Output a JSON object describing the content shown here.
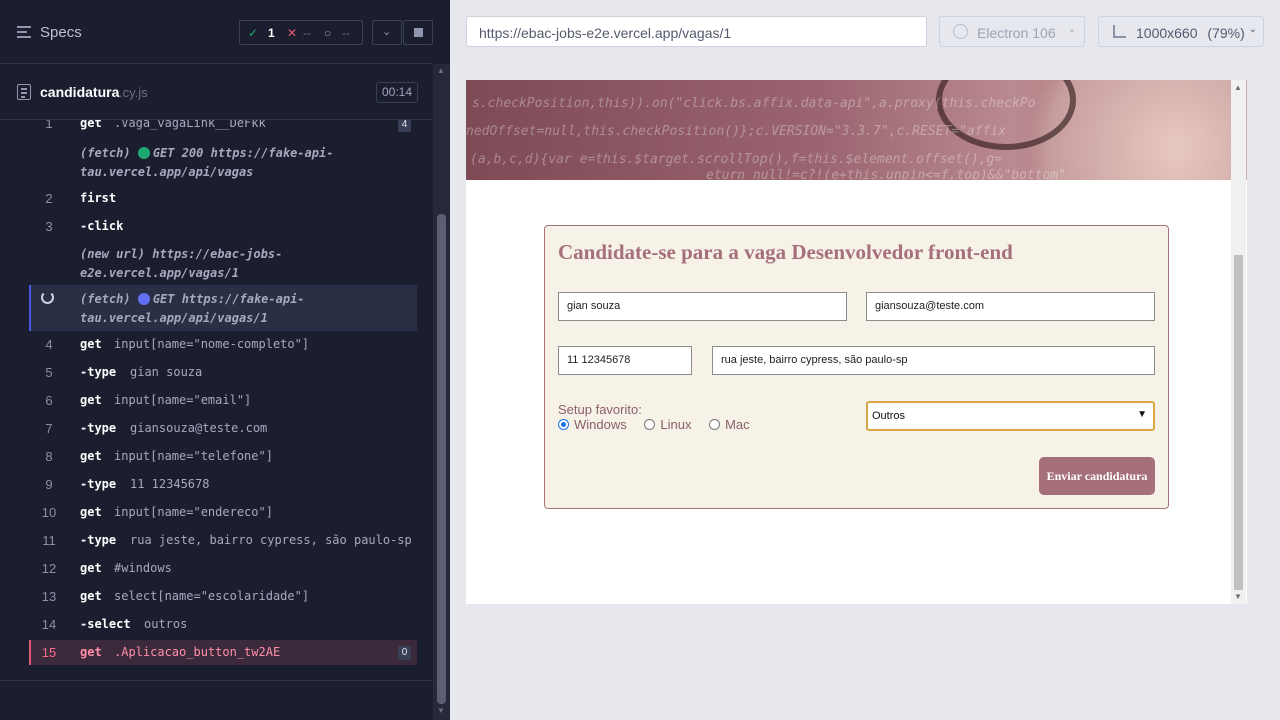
{
  "specs": {
    "label": "Specs",
    "passed": "1",
    "failed": "--",
    "pending": "--"
  },
  "file": {
    "name": "candidatura",
    "ext": ".cy.js",
    "duration": "00:14"
  },
  "commands": [
    {
      "num": "1",
      "name": "get",
      "msg": ".Vaga_vagaLink__DeFkk",
      "badge": "4"
    },
    {
      "fetch": "(fetch)",
      "method": "GET 200 https://fake-api-",
      "cont": "tau.vercel.app/api/vagas"
    },
    {
      "num": "2",
      "name": "first",
      "msg": ""
    },
    {
      "num": "3",
      "name": "-click",
      "msg": ""
    },
    {
      "newurl": "(new url)",
      "url1": "https://ebac-jobs-",
      "url2": "e2e.vercel.app/vagas/1"
    },
    {
      "fetch": "(fetch)",
      "method": "GET https://fake-api-",
      "cont": "tau.vercel.app/api/vagas/1"
    },
    {
      "num": "4",
      "name": "get",
      "msg": "input[name=\"nome-completo\"]"
    },
    {
      "num": "5",
      "name": "-type",
      "msg": "gian souza"
    },
    {
      "num": "6",
      "name": "get",
      "msg": "input[name=\"email\"]"
    },
    {
      "num": "7",
      "name": "-type",
      "msg": "giansouza@teste.com"
    },
    {
      "num": "8",
      "name": "get",
      "msg": "input[name=\"telefone\"]"
    },
    {
      "num": "9",
      "name": "-type",
      "msg": "11 12345678"
    },
    {
      "num": "10",
      "name": "get",
      "msg": "input[name=\"endereco\"]"
    },
    {
      "num": "11",
      "name": "-type",
      "msg": "rua jeste, bairro cypress, são paulo-sp"
    },
    {
      "num": "12",
      "name": "get",
      "msg": "#windows"
    },
    {
      "num": "13",
      "name": "get",
      "msg": "select[name=\"escolaridade\"]"
    },
    {
      "num": "14",
      "name": "-select",
      "msg": "outros"
    },
    {
      "num": "15",
      "name": "get",
      "msg": ".Aplicacao_button_tw2AE",
      "badge": "0"
    }
  ],
  "browser": {
    "url": "https://ebac-jobs-e2e.vercel.app/vagas/1",
    "engine": "Electron 106",
    "viewport": "1000x660",
    "zoom": "(79%)"
  },
  "hero_code": [
    "s.checkPosition,this)).on(\"click.bs.affix.data-api\",a.proxy(this.checkPo",
    "nedOffset=null,this.checkPosition()};c.VERSION=\"3.3.7\",c.RESET=\"affix",
    "(a,b,c,d){var e=this.$target.scrollTop(),f=this.$element.offset(),g=",
    "eturn null!=c?!(e+this.unpin<=f.top)&&\"bottom\""
  ],
  "form": {
    "title": "Candidate-se para a vaga Desenvolvedor front-end",
    "nome": "gian souza",
    "email": "giansouza@teste.com",
    "telefone": "11 12345678",
    "endereco": "rua jeste, bairro cypress, são paulo-sp",
    "setup_label": "Setup favorito:",
    "options": [
      "Windows",
      "Linux",
      "Mac"
    ],
    "selected_option": "Windows",
    "escolaridade": "Outros",
    "submit": "Enviar candidatura"
  },
  "colors": {
    "accent": "#a6707a",
    "failed_row": "#3b2a3c",
    "active_row": "#2a2f45",
    "passed": "#1fa971",
    "failed": "#e45770"
  }
}
